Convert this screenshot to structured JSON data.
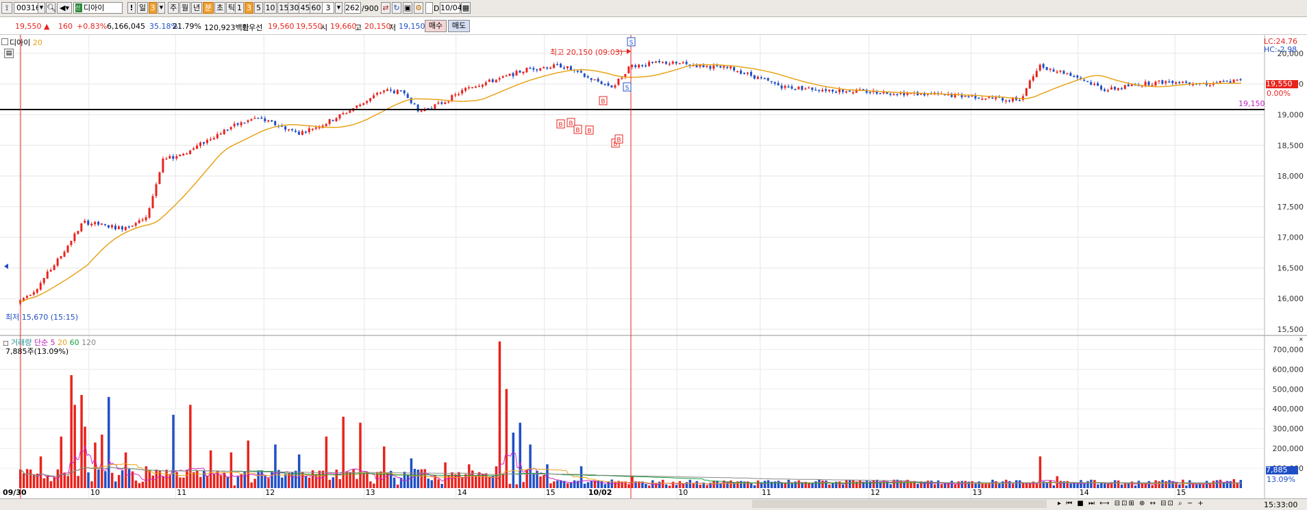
{
  "toolbar": {
    "code": "003160",
    "name": "디아이",
    "period_d": "일",
    "period_num": "3",
    "periods": [
      "주",
      "월",
      "년",
      "분",
      "초",
      "틱"
    ],
    "minutes": [
      "1",
      "3",
      "5",
      "10",
      "15",
      "30",
      "45",
      "60"
    ],
    "count_value": "3",
    "range_value": "262",
    "range_total": "/900",
    "date_value": "10/04",
    "d_label": "D"
  },
  "info": {
    "price": "19,550 ▲",
    "change": "160",
    "change_pct": "+0.83%",
    "volume": "6,166,045",
    "pct1": "35.18%",
    "pct2": "21.79%",
    "amount": "120,923백만",
    "best_ask_label": "최우선",
    "best_ask": "19,560",
    "best_bid": "19,550",
    "open_label": "시",
    "open": "19,660",
    "high_label": "고",
    "high": "20,150",
    "low_label": "저",
    "low": "19,150",
    "buy_button": "매수",
    "sell_button": "매도"
  },
  "price_panel": {
    "legend_name": "디아이",
    "legend_ma": "20",
    "max_label": "최고 20,150 (09:03)",
    "min_label": "최저 15,670 (15:15)",
    "lc_label": "LC:24.76",
    "hc_label": "HC:-2.98",
    "current_price_tag": "19,550",
    "current_pct": "0.00%",
    "hline_value": "19,150",
    "buy_marker": "B",
    "sell_marker": "S",
    "yticks": [
      "20,000",
      "19,500",
      "19,000",
      "18,500",
      "18,000",
      "17,500",
      "17,000",
      "16,500",
      "16,000",
      "15,500"
    ]
  },
  "volume_panel": {
    "legend_name": "거래량",
    "legend_type": "단순",
    "legend_ma": [
      "5",
      "20",
      "60",
      "120"
    ],
    "value_text": "7,885주(13.09%)",
    "current_tag": "7,885",
    "current_pct": "13.09%",
    "yticks": [
      "700,000",
      "600,000",
      "500,000",
      "400,000",
      "300,000",
      "200,000",
      "100,000"
    ]
  },
  "x_axis": {
    "labels": [
      "09/30",
      "10",
      "11",
      "12",
      "13",
      "14",
      "15",
      "10/02",
      "10",
      "11",
      "12",
      "13",
      "14",
      "15"
    ],
    "time": "15:33:00"
  },
  "colors": {
    "up": "#e8231d",
    "down": "#1f4fc6",
    "ma20": "#e8a317",
    "ma5": "#d025c8",
    "ma60": "#159e3a",
    "ma120": "#888888"
  },
  "chart_data": {
    "type": "candlestick",
    "price_range": [
      15400,
      20300
    ],
    "volume_range": [
      0,
      760000
    ],
    "session_labels": [
      "09/30",
      "10",
      "11",
      "12",
      "13",
      "14",
      "15",
      "10/02",
      "10",
      "11",
      "12",
      "13",
      "14",
      "15"
    ],
    "anchor_path": [
      [
        0,
        15950
      ],
      [
        10,
        16150
      ],
      [
        25,
        16700
      ],
      [
        38,
        17250
      ],
      [
        60,
        17150
      ],
      [
        75,
        17300
      ],
      [
        85,
        18250
      ],
      [
        100,
        18400
      ],
      [
        115,
        18650
      ],
      [
        125,
        18800
      ],
      [
        140,
        18950
      ],
      [
        150,
        18850
      ],
      [
        165,
        18700
      ],
      [
        180,
        18850
      ],
      [
        200,
        19150
      ],
      [
        215,
        19400
      ],
      [
        228,
        19350
      ],
      [
        235,
        19050
      ],
      [
        250,
        19200
      ],
      [
        265,
        19450
      ],
      [
        285,
        19600
      ],
      [
        300,
        19750
      ],
      [
        320,
        19800
      ],
      [
        335,
        19600
      ],
      [
        350,
        19450
      ],
      [
        360,
        19800
      ],
      [
        380,
        19850
      ],
      [
        400,
        19800
      ],
      [
        420,
        19750
      ],
      [
        450,
        19450
      ],
      [
        480,
        19400
      ],
      [
        520,
        19350
      ],
      [
        560,
        19300
      ],
      [
        580,
        19250
      ],
      [
        590,
        19250
      ],
      [
        600,
        19800
      ],
      [
        620,
        19650
      ],
      [
        640,
        19400
      ],
      [
        660,
        19500
      ],
      [
        680,
        19550
      ],
      [
        700,
        19500
      ],
      [
        715,
        19550
      ],
      [
        720,
        19550
      ]
    ],
    "volume_spikes": [
      [
        4,
        30000
      ],
      [
        8,
        70000
      ],
      [
        12,
        160000
      ],
      [
        24,
        260000
      ],
      [
        30,
        570000
      ],
      [
        33,
        420000
      ],
      [
        36,
        470000
      ],
      [
        39,
        310000
      ],
      [
        44,
        230000
      ],
      [
        48,
        270000
      ],
      [
        53,
        460000
      ],
      [
        62,
        180000
      ],
      [
        75,
        110000
      ],
      [
        90,
        370000
      ],
      [
        100,
        420000
      ],
      [
        112,
        190000
      ],
      [
        125,
        180000
      ],
      [
        135,
        240000
      ],
      [
        150,
        220000
      ],
      [
        165,
        170000
      ],
      [
        180,
        260000
      ],
      [
        190,
        360000
      ],
      [
        200,
        330000
      ],
      [
        215,
        210000
      ],
      [
        230,
        150000
      ],
      [
        250,
        130000
      ],
      [
        265,
        120000
      ],
      [
        280,
        110000
      ],
      [
        283,
        740000
      ],
      [
        286,
        500000
      ],
      [
        290,
        280000
      ],
      [
        295,
        330000
      ],
      [
        300,
        220000
      ],
      [
        310,
        120000
      ],
      [
        330,
        110000
      ],
      [
        360,
        60000
      ],
      [
        470,
        40000
      ],
      [
        600,
        160000
      ],
      [
        610,
        60000
      ],
      [
        705,
        40000
      ],
      [
        715,
        45000
      ]
    ],
    "ma_volume_level": {
      "ma5": "fast",
      "ma20": "medium",
      "ma60": "slow",
      "ma120": "slowest"
    }
  }
}
